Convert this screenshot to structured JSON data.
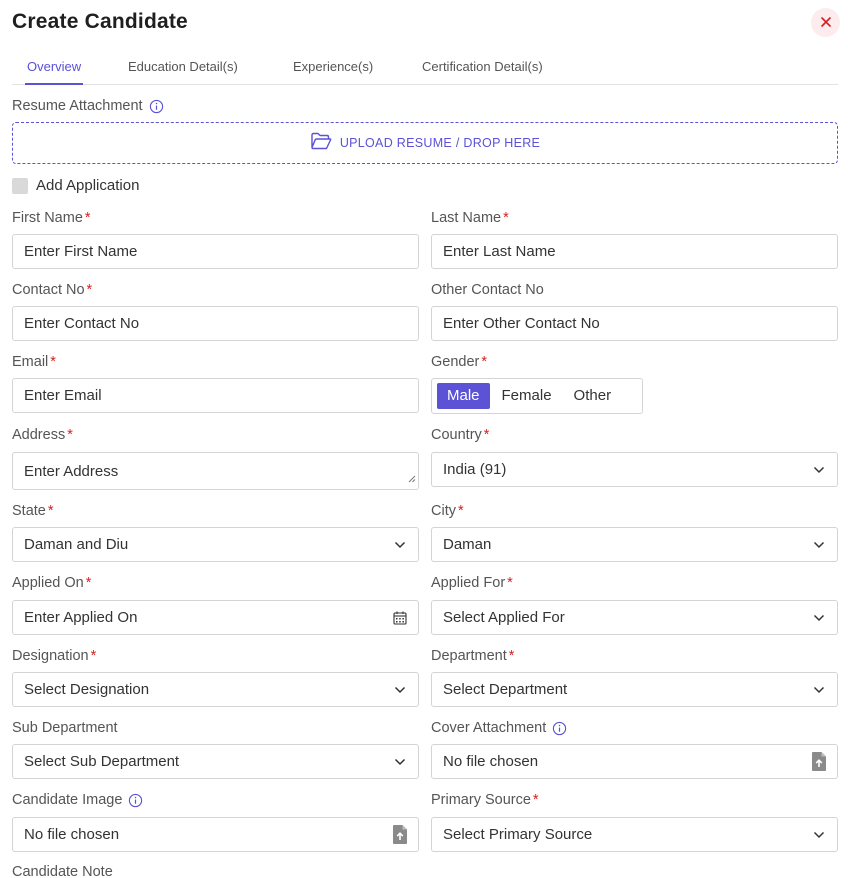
{
  "header": {
    "title": "Create Candidate"
  },
  "tabs": [
    {
      "label": "Overview"
    },
    {
      "label": "Education Detail(s)"
    },
    {
      "label": "Experience(s)"
    },
    {
      "label": "Certification Detail(s)"
    }
  ],
  "resume": {
    "label": "Resume Attachment",
    "upload_text": "UPLOAD RESUME / DROP HERE"
  },
  "add_application": {
    "label": "Add Application",
    "checked": false
  },
  "fields": {
    "first_name": {
      "label": "First Name",
      "placeholder": "Enter First Name"
    },
    "last_name": {
      "label": "Last Name",
      "placeholder": "Enter Last Name"
    },
    "contact_no": {
      "label": "Contact No",
      "placeholder": "Enter Contact No"
    },
    "other_contact_no": {
      "label": "Other Contact No",
      "placeholder": "Enter Other Contact No"
    },
    "email": {
      "label": "Email",
      "placeholder": "Enter Email"
    },
    "gender": {
      "label": "Gender",
      "options": [
        "Male",
        "Female",
        "Other"
      ],
      "selected": "Male"
    },
    "address": {
      "label": "Address",
      "placeholder": "Enter Address"
    },
    "country": {
      "label": "Country",
      "value": "India (91)"
    },
    "state": {
      "label": "State",
      "value": "Daman and Diu"
    },
    "city": {
      "label": "City",
      "value": "Daman"
    },
    "applied_on": {
      "label": "Applied On",
      "placeholder": "Enter Applied On"
    },
    "applied_for": {
      "label": "Applied For",
      "value": "Select Applied For"
    },
    "designation": {
      "label": "Designation",
      "value": "Select Designation"
    },
    "department": {
      "label": "Department",
      "value": "Select Department"
    },
    "sub_department": {
      "label": "Sub Department",
      "value": "Select Sub Department"
    },
    "cover_attachment": {
      "label": "Cover Attachment",
      "value": "No file chosen"
    },
    "candidate_image": {
      "label": "Candidate Image",
      "value": "No file chosen"
    },
    "primary_source": {
      "label": "Primary Source",
      "value": "Select Primary Source"
    },
    "candidate_note": {
      "label": "Candidate Note"
    }
  },
  "icons": {
    "close": "close-icon",
    "info": "info-icon",
    "folder": "folder-open-icon",
    "chevron": "chevron-down-icon",
    "calendar": "calendar-icon",
    "file_upload": "file-upload-icon"
  },
  "colors": {
    "accent": "#5b52d6",
    "required": "#d61f1f",
    "close_bg": "#fdecee",
    "close_x": "#d61f1f"
  }
}
